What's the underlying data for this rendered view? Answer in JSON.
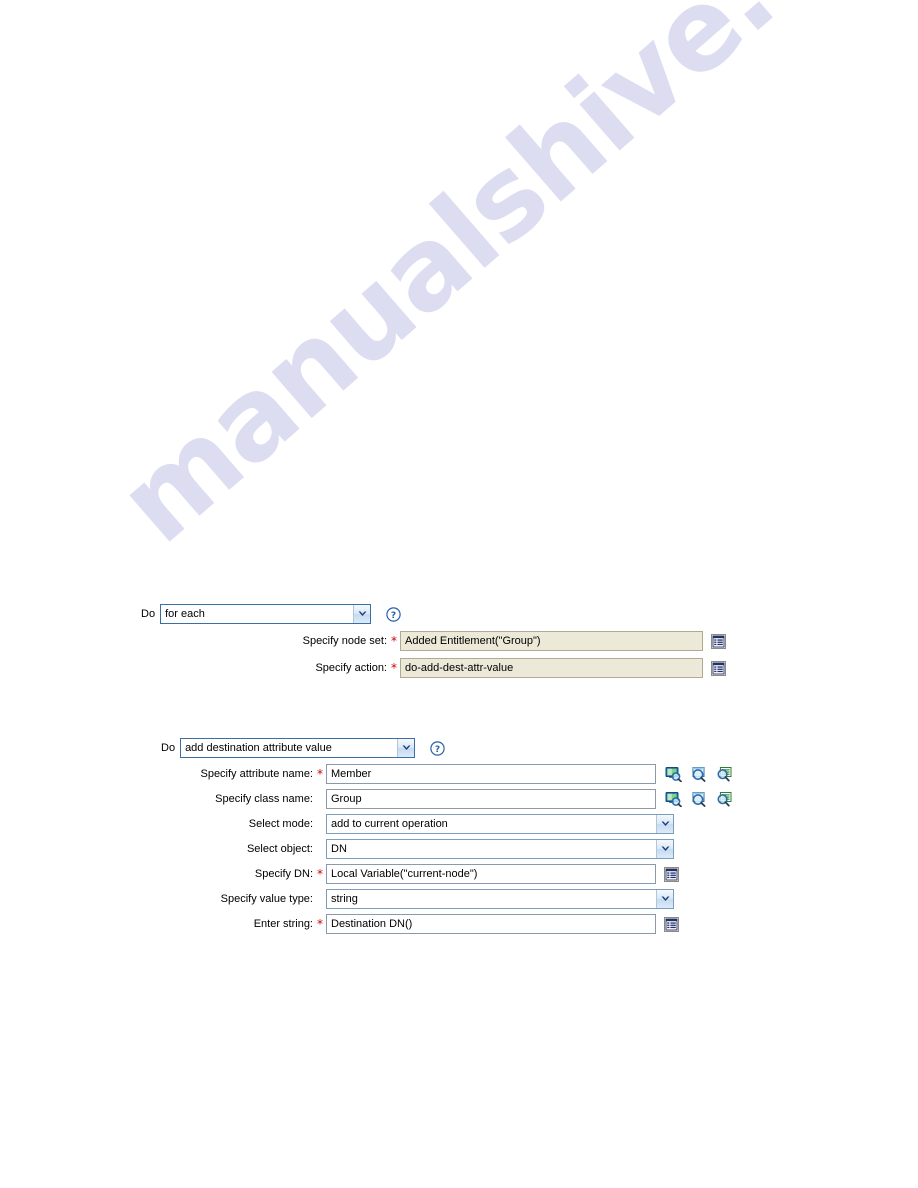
{
  "watermark": {
    "text": "manualshive.com"
  },
  "blocks": [
    {
      "id": "for-each",
      "do_label": "Do",
      "action": "for each",
      "help_icon": "help-icon",
      "fields": [
        {
          "label": "Specify node set:",
          "required": true,
          "control": "text-readonly",
          "value": "Added Entitlement(\"Group\")",
          "trailing_icons": [
            "argument-builder-icon"
          ]
        },
        {
          "label": "Specify action:",
          "required": true,
          "control": "text-readonly",
          "value": "do-add-dest-attr-value",
          "trailing_icons": [
            "argument-builder-icon"
          ]
        }
      ]
    },
    {
      "id": "add-destination-attribute-value",
      "do_label": "Do",
      "action": "add destination attribute value",
      "help_icon": "help-icon",
      "fields": [
        {
          "label": "Specify attribute name:",
          "required": true,
          "control": "text",
          "value": "Member",
          "trailing_icons": [
            "browse-schema-icon",
            "browse-attribute-icon",
            "browse-list-icon"
          ]
        },
        {
          "label": "Specify class name:",
          "required": false,
          "control": "text",
          "value": "Group",
          "trailing_icons": [
            "browse-schema-icon",
            "browse-attribute-icon",
            "browse-list-icon"
          ]
        },
        {
          "label": "Select mode:",
          "required": false,
          "control": "combo",
          "value": "add to current operation",
          "trailing_icons": []
        },
        {
          "label": "Select object:",
          "required": false,
          "control": "combo",
          "value": "DN",
          "trailing_icons": []
        },
        {
          "label": "Specify DN:",
          "required": true,
          "control": "text",
          "value": "Local Variable(\"current-node\")",
          "trailing_icons": [
            "argument-builder-icon"
          ]
        },
        {
          "label": "Specify value type:",
          "required": false,
          "control": "combo",
          "value": "string",
          "trailing_icons": []
        },
        {
          "label": "Enter string:",
          "required": true,
          "control": "text",
          "value": "Destination DN()",
          "trailing_icons": [
            "argument-builder-icon"
          ]
        }
      ]
    }
  ],
  "colors": {
    "readonly_field_bg": "#ECE9D8",
    "field_border": "#8A9AAA",
    "combo_border": "#7B9EBD",
    "required_star": "#CC0000",
    "help_blue": "#2A62A8",
    "watermark": "#DCDCF2"
  }
}
